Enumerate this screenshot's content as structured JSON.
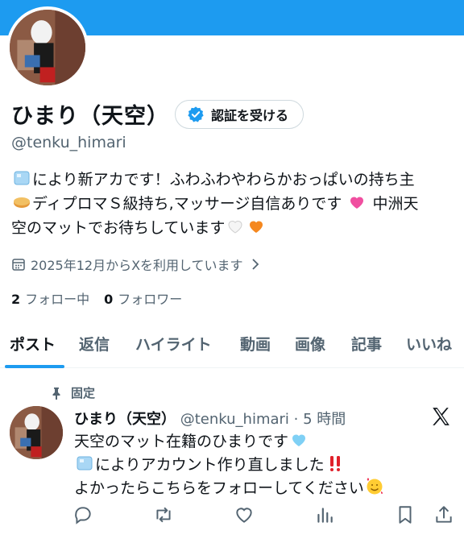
{
  "profile": {
    "display_name": "ひまり（天空）",
    "verify_label": "認証を受ける",
    "handle": "@tenku_himari",
    "bio_lines": [
      "により新アカです！ふわふわやわらかおっぱいの持ち主",
      "ディプロマＳ級持ち,マッサージ自信ありです",
      "中洲天",
      "空のマットでお待ちしています"
    ],
    "joined": "2025年12月からXを利用しています",
    "following_count": "2",
    "following_label": "フォロー中",
    "followers_count": "0",
    "followers_label": "フォロワー"
  },
  "tabs": [
    {
      "label": "ポスト"
    },
    {
      "label": "返信"
    },
    {
      "label": "ハイライト"
    },
    {
      "label": "動画"
    },
    {
      "label": "画像"
    },
    {
      "label": "記事"
    },
    {
      "label": "いいね"
    }
  ],
  "post": {
    "pinned_label": "固定",
    "author_name": "ひまり（天空）",
    "meta": "@tenku_himari · 5 時間",
    "lines": [
      "天空のマット在籍のひまりです",
      "によりアカウント作り直しました",
      "よかったらこちらをフォローしてください"
    ]
  },
  "colors": {
    "accent": "#1d9bf0",
    "text": "#0f1419",
    "secondary": "#536471"
  },
  "icons": [
    "calendar-icon",
    "chevron-right-icon",
    "pin-icon",
    "x-logo-icon",
    "reply-icon",
    "retweet-icon",
    "like-icon",
    "views-icon",
    "bookmark-icon",
    "share-icon",
    "verified-badge-icon"
  ]
}
